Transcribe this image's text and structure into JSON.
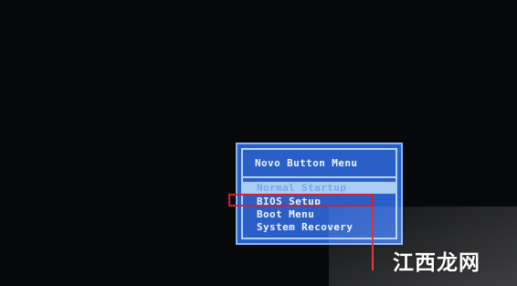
{
  "menu": {
    "title": "Novo Button Menu",
    "items": [
      {
        "label": "Normal Startup",
        "selected": true
      },
      {
        "label": "BIOS Setup",
        "selected": false
      },
      {
        "label": "Boot Menu",
        "selected": false
      },
      {
        "label": "System Recovery",
        "selected": false
      }
    ]
  },
  "annotation": {
    "color": "#d4202c",
    "target": "BIOS Setup"
  },
  "watermark": {
    "text": "江西龙网"
  },
  "colors": {
    "background": "#07080a",
    "menu_background": "#2a5fc8",
    "menu_border": "#b6d0f6",
    "selected_background": "#aacdf6",
    "text": "#f0f4ff"
  }
}
